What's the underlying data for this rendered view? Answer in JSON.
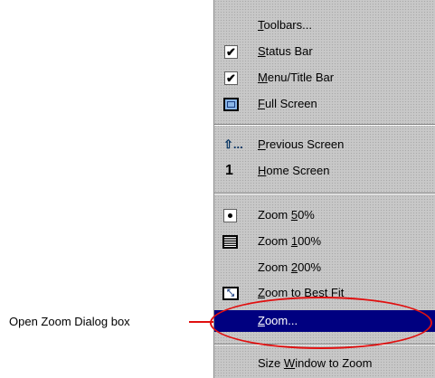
{
  "annotation": {
    "label": "Open Zoom Dialog box"
  },
  "menu": {
    "items": [
      {
        "label_pre": "",
        "mnemonic": "T",
        "label_post": "oolbars...",
        "icon": "none"
      },
      {
        "label_pre": "",
        "mnemonic": "S",
        "label_post": "tatus Bar",
        "icon": "checkmark-icon",
        "checked": true
      },
      {
        "label_pre": "",
        "mnemonic": "M",
        "label_post": "enu/Title Bar",
        "icon": "checkmark-icon",
        "checked": true
      },
      {
        "label_pre": "",
        "mnemonic": "F",
        "label_post": "ull Screen",
        "icon": "full-screen-icon"
      },
      {
        "label_pre": "",
        "mnemonic": "P",
        "label_post": "revious Screen",
        "icon": "previous-screen-icon"
      },
      {
        "label_pre": "",
        "mnemonic": "H",
        "label_post": "ome Screen",
        "icon": "home-screen-icon"
      },
      {
        "label_pre": "Zoom ",
        "mnemonic": "5",
        "label_post": "0%",
        "icon": "radio-bullet-icon",
        "selected_option": true
      },
      {
        "label_pre": "Zoom ",
        "mnemonic": "1",
        "label_post": "00%",
        "icon": "zoom-100-icon"
      },
      {
        "label_pre": "Zoom ",
        "mnemonic": "2",
        "label_post": "00%",
        "icon": "none"
      },
      {
        "label_pre": "",
        "mnemonic": "Z",
        "label_post": "oom to Best Fit",
        "icon": "best-fit-icon"
      },
      {
        "label_pre": "",
        "mnemonic": "Z",
        "label_post": "oom...",
        "icon": "none",
        "highlighted": true
      },
      {
        "label_pre": "Size ",
        "mnemonic": "W",
        "label_post": "indow to Zoom",
        "icon": "none"
      }
    ],
    "icon_glyphs": {
      "check": "✔",
      "previous": "⇧...",
      "home": "1",
      "fit": "⤡"
    }
  },
  "colors": {
    "highlight": "#000080",
    "annotation": "#e01010"
  }
}
